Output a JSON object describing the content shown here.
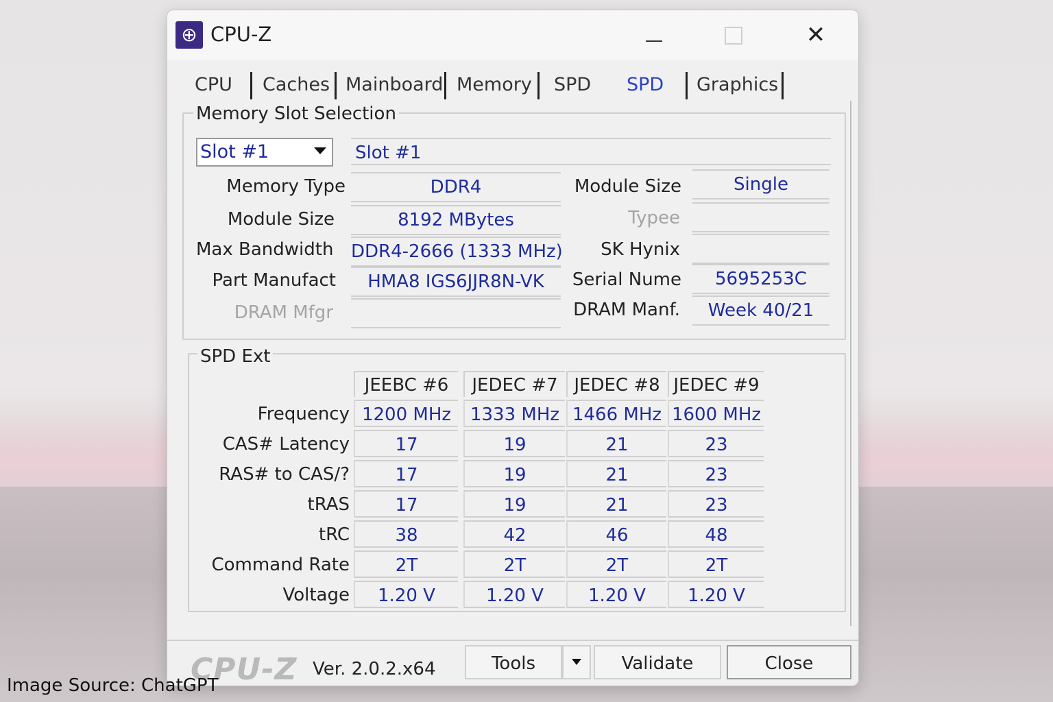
{
  "window": {
    "title": "CPU-Z",
    "icon": "cpu-z-app-icon",
    "controls": {
      "minimize": "—",
      "close": "✕"
    }
  },
  "tabs": [
    "CPU",
    "Caches",
    "Mainboard",
    "Memory",
    "SPD",
    "SPD",
    "Graphics"
  ],
  "active_tab_index": 5,
  "slot_group": {
    "title": "Memory Slot Selection",
    "slot_select": "Slot #1",
    "slot_label": "Slot #1",
    "left_labels": {
      "memory_type": "Memory Type",
      "module_size": "Module Size",
      "max_bandwidth": "Max Bandwidth",
      "part_manufact": "Part Manufact",
      "dram_mfg": "DRAM Mfgr"
    },
    "left_values": {
      "memory_type": "DDR4",
      "module_size": "8192 MBytes",
      "max_bandwidth": "DDR4-2666 (1333 MHz)",
      "part_manufact": "HMA8 IGS6JJR8N-VK",
      "dram_mfg": ""
    },
    "right_labels": {
      "module_size": "Module Size",
      "type": "Typee",
      "sk_hynix": "SK Hynix",
      "serial_num": "Serial Nume",
      "dram_manf": "DRAM Manf."
    },
    "right_values": {
      "module_size": "Single",
      "type": "",
      "sk_hynix": "",
      "serial_num": "5695253C",
      "dram_manf": "Week 40/21"
    }
  },
  "spd_ext": {
    "title": "SPD Ext",
    "columns": [
      "JEEBC #6",
      "JEDEC #7",
      "JEDEC #8",
      "JEDEC #9"
    ],
    "rows": [
      {
        "label": "Frequency",
        "values": [
          "1200 MHz",
          "1333 MHz",
          "1466 MHz",
          "1600 MHz"
        ]
      },
      {
        "label": "CAS# Latency",
        "values": [
          "17",
          "19",
          "21",
          "23"
        ]
      },
      {
        "label": "RAS# to CAS/?",
        "values": [
          "17",
          "19",
          "21",
          "23"
        ]
      },
      {
        "label": "tRAS",
        "values": [
          "17",
          "19",
          "21",
          "23"
        ]
      },
      {
        "label": "tRC",
        "values": [
          "38",
          "42",
          "46",
          "48"
        ]
      },
      {
        "label": "Command Rate",
        "values": [
          "2T",
          "2T",
          "2T",
          "2T"
        ]
      },
      {
        "label": "Voltage",
        "values": [
          "1.20 V",
          "1.20 V",
          "1.20 V",
          "1.20 V"
        ]
      }
    ]
  },
  "footer": {
    "brand": "CPU-Z",
    "version": "Ver. 2.0.2.x64",
    "tools_label": "Tools",
    "validate_label": "Validate",
    "close_label": "Close"
  },
  "caption": "Image Source: ChatGPT",
  "colors": {
    "value_text": "#1f2c9b",
    "active_tab": "#2b41c7",
    "window_bg": "#f0f0f0"
  }
}
